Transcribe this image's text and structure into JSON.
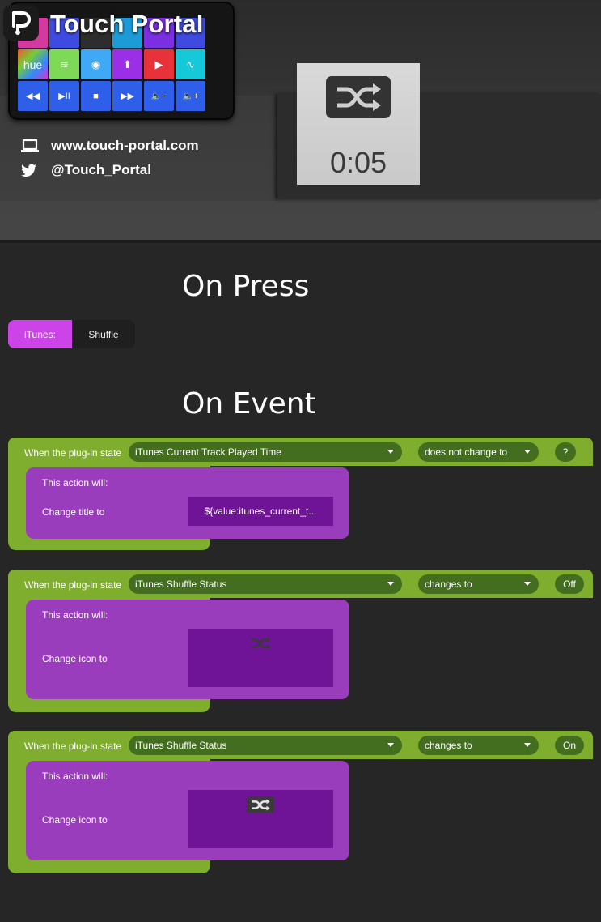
{
  "header": {
    "brand": "Touch Portal",
    "website": "www.touch-portal.com",
    "twitter": "@Touch_Portal",
    "phone_tiles": [
      {
        "kind": "top1",
        "label": ""
      },
      {
        "kind": "top2",
        "label": ""
      },
      {
        "kind": "top3",
        "label": ""
      },
      {
        "kind": "top4",
        "label": ""
      },
      {
        "kind": "top5",
        "label": ""
      },
      {
        "kind": "top2",
        "label": ""
      },
      {
        "kind": "hue",
        "label": "hue"
      },
      {
        "kind": "spotify",
        "label": "spotify-icon"
      },
      {
        "kind": "plex",
        "label": "plex-icon"
      },
      {
        "kind": "nav",
        "label": "nav-icon"
      },
      {
        "kind": "yt",
        "label": "youtube-icon"
      },
      {
        "kind": "wav",
        "label": "wave-icon"
      },
      {
        "kind": "blue",
        "label": "◀◀"
      },
      {
        "kind": "blue",
        "label": "▶II"
      },
      {
        "kind": "blue",
        "label": "■"
      },
      {
        "kind": "blue",
        "label": "▶▶"
      },
      {
        "kind": "blue",
        "label": "🔈−"
      },
      {
        "kind": "blue",
        "label": "🔈+"
      }
    ]
  },
  "preview": {
    "icon": "shuffle-icon",
    "time": "0:05"
  },
  "on_press": {
    "title": "On Press",
    "plugin": "iTunes:",
    "action": "Shuffle"
  },
  "on_event": {
    "title": "On Event",
    "events": [
      {
        "when_label": "When the plug-in state",
        "state": "iTunes Current Track Played Time",
        "condition": "does not change to",
        "value": "?",
        "action_title": "This action will:",
        "action_label": "Change title to",
        "action_value": "${value:itunes_current_t..."
      },
      {
        "when_label": "When the plug-in state",
        "state": "iTunes Shuffle Status",
        "condition": "changes to",
        "value": "Off",
        "action_title": "This action will:",
        "action_label": "Change icon to",
        "action_icon": "shuffle-icon"
      },
      {
        "when_label": "When the plug-in state",
        "state": "iTunes Shuffle Status",
        "condition": "changes to",
        "value": "On",
        "action_title": "This action will:",
        "action_label": "Change icon to",
        "action_icon": "shuffle-icon"
      }
    ]
  },
  "colors": {
    "background": "#262626",
    "event_green": "#7fad2e",
    "pill_green": "#436e20",
    "action_purple": "#9a3dbd",
    "field_purple": "#6f1497",
    "plugin_pink": "#cc44e8"
  }
}
